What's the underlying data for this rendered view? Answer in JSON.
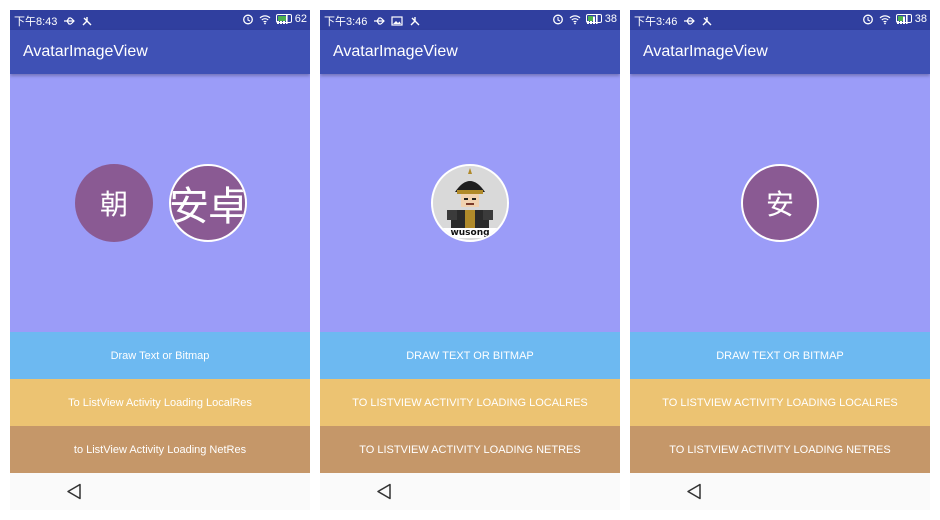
{
  "colors": {
    "status_bar": "#303f9f",
    "app_bar": "#3f51b5",
    "canvas": "#9b9cf8",
    "avatar": "#8a5a93",
    "button_1": "#6db9f1",
    "button_2": "#ecc372",
    "button_3": "#c59769",
    "battery": "#4caf50"
  },
  "phones": [
    {
      "status": {
        "time": "下午8:43",
        "battery": "62",
        "left_icons": [
          "usb-icon",
          "debug-icon"
        ],
        "right_icons": [
          "alarm-icon",
          "wifi-icon",
          "signal-icon",
          "battery-icon"
        ]
      },
      "app_title": "AvatarImageView",
      "avatars": [
        {
          "text": "朝",
          "kind": "text"
        },
        {
          "text": "安卓",
          "kind": "text"
        }
      ],
      "buttons": [
        "Draw Text or Bitmap",
        "To ListView Activity Loading LocalRes",
        "to ListView Activity Loading NetRes"
      ]
    },
    {
      "status": {
        "time": "下午3:46",
        "battery": "38",
        "left_icons": [
          "usb-icon",
          "image-icon",
          "debug-icon"
        ],
        "right_icons": [
          "alarm-icon",
          "wifi-icon",
          "signal-icon",
          "battery-icon"
        ]
      },
      "app_title": "AvatarImageView",
      "avatars": [
        {
          "text": "wusong",
          "kind": "bitmap",
          "icon": "warrior-cartoon-icon"
        }
      ],
      "buttons": [
        "DRAW TEXT OR BITMAP",
        "TO LISTVIEW ACTIVITY LOADING LOCALRES",
        "TO LISTVIEW ACTIVITY LOADING NETRES"
      ]
    },
    {
      "status": {
        "time": "下午3:46",
        "battery": "38",
        "left_icons": [
          "usb-icon",
          "debug-icon"
        ],
        "right_icons": [
          "alarm-icon",
          "wifi-icon",
          "signal-icon",
          "battery-icon"
        ]
      },
      "app_title": "AvatarImageView",
      "avatars": [
        {
          "text": "安",
          "kind": "text"
        }
      ],
      "buttons": [
        "DRAW TEXT OR BITMAP",
        "TO LISTVIEW ACTIVITY LOADING LOCALRES",
        "TO LISTVIEW ACTIVITY LOADING NETRES"
      ]
    }
  ]
}
